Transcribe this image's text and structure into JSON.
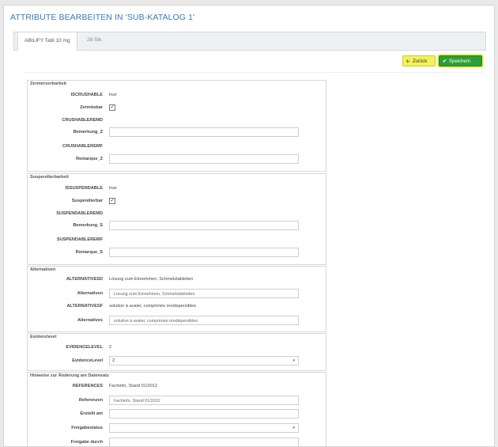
{
  "header": {
    "title": "ATTRIBUTE BEARBEITEN IN 'SUB-KATALOG 1'"
  },
  "tabs": [
    {
      "label": "ABILIFY Tabl 10 mg"
    },
    {
      "label": "28 Stk"
    }
  ],
  "toolbar": {
    "back_label": "Zurück",
    "save_label": "Speichern",
    "back_icon": "arrow-left-icon",
    "save_icon": "check-icon"
  },
  "groups": {
    "zermoerserbarkeit": {
      "legend": "Zermörserbarkeit",
      "iscrushable_label": "ISCRUSHABLE",
      "iscrushable_value": "true",
      "zermoesbar_label": "Zermösbar",
      "zermoesbar_checked": "✓",
      "crushableremd_label": "CRUSHABLEREMD",
      "bemerkung_label": "Bemerkung_Z",
      "bemerkung_value": "",
      "crushableremf_label": "CRUSHABLEREMF",
      "remarque_label": "Remarque_Z",
      "remarque_value": ""
    },
    "suspendierbarkeit": {
      "legend": "Suspendierbarkeit",
      "issuspendable_label": "ISSUSPENDABLE",
      "issuspendable_value": "true",
      "suspendierbar_label": "Suspendierbar",
      "suspendierbar_checked": "✓",
      "suspendableremd_label": "SUSPENDABLEREMD",
      "bemerkung_label": "Bemerkung_S",
      "bemerkung_value": "",
      "suspendableremf_label": "SUSPENDABLEREMF",
      "remarque_label": "Remarque_S",
      "remarque_value": ""
    },
    "alternativen": {
      "legend": "Alternativen",
      "alternativesd_label": "ALTERNATIVESD",
      "alternativesd_value": "Lösung zum Einnehmen, Schmelztabletten",
      "alternativen_label": "Alternativen",
      "alternativen_value": "Lösung zum Einnehmen, Schmelztabletten",
      "alternativesf_label": "ALTERNATIVESF",
      "alternativesf_value": "solution à avaler, comprimés orodispersibles",
      "alternatives_label": "Alternatives",
      "alternatives_value": "solution à avaler, comprimés orodispersibles"
    },
    "evidenzlevel": {
      "legend": "Evidenzlevel",
      "evidencelevel_label": "EVIDENCELEVEL",
      "evidencelevel_value": "2",
      "evidencelevel2_label": "EvidenceLevel",
      "evidencelevel2_value": "2"
    },
    "hinweise": {
      "legend": "Hinweise zur Änderung am Datensatz",
      "references_label": "REFERENCES",
      "references_value": "Fachinfo, Stand 01/2012",
      "referenzen_label": "Referenzen",
      "referenzen_value": "Fachinfo, Stand 01/2012",
      "erstellt_label": "Erstellt am",
      "erstellt_value": "",
      "freigabestatus_label": "Freigabestatus",
      "freigabestatus_value": "",
      "freigabe_durch_label": "Freigabe durch",
      "freigabe_durch_value": ""
    }
  }
}
